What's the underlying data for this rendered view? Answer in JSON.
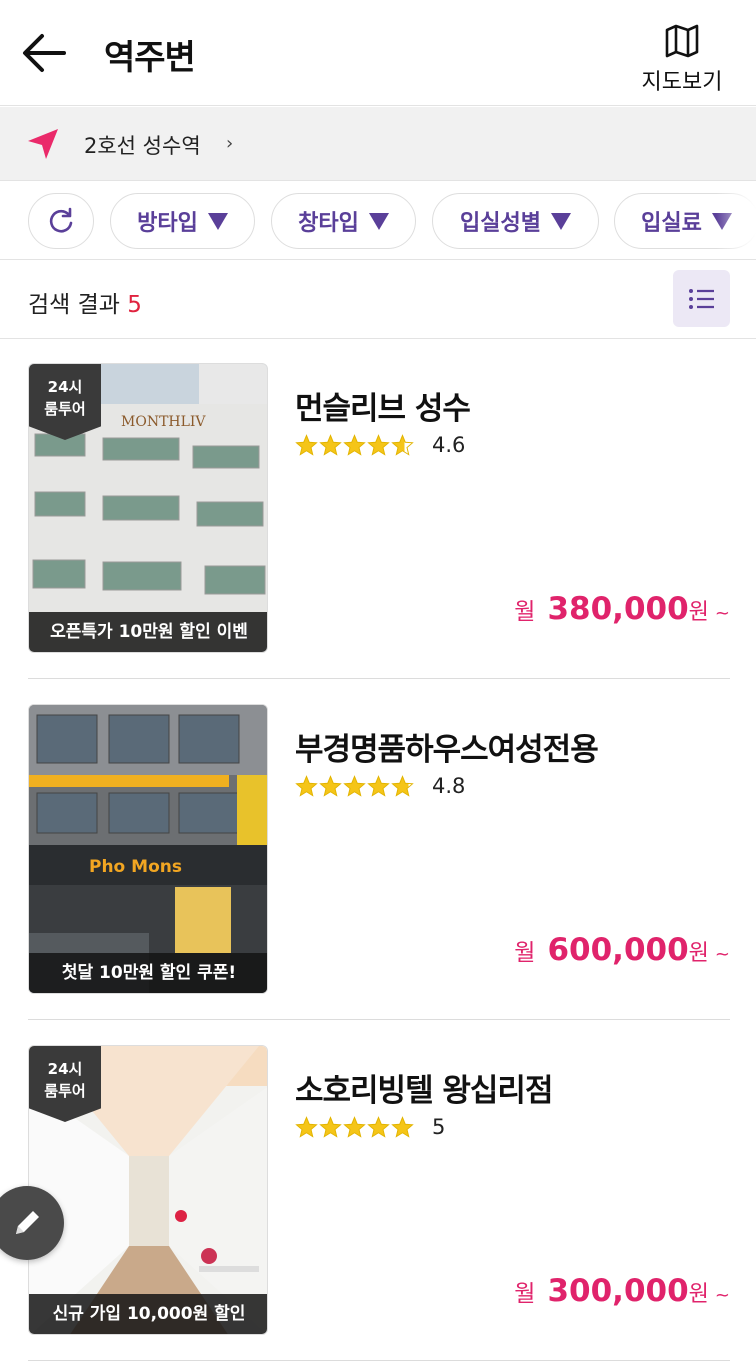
{
  "header": {
    "title": "역주변",
    "map_label": "지도보기"
  },
  "location": {
    "text": "2호선 성수역",
    "chevron": "›"
  },
  "filters": [
    {
      "label": "방타입"
    },
    {
      "label": "창타입"
    },
    {
      "label": "입실성별"
    },
    {
      "label": "입실료"
    }
  ],
  "results": {
    "label": "검색 결과",
    "count": "5"
  },
  "listings": [
    {
      "name": "먼슬리브 성수",
      "rating": "4.6",
      "rating_value": 4.6,
      "badge": [
        "24시",
        "룸투어"
      ],
      "promo": "오픈특가 10만원 할인 이벤",
      "price_prefix": "월",
      "price": "380,000",
      "price_suffix": "원",
      "price_tilde": "~",
      "sign_text": "MONTHLIV"
    },
    {
      "name": "부경명품하우스여성전용",
      "rating": "4.8",
      "rating_value": 4.8,
      "badge": [],
      "promo": "첫달 10만원 할인 쿠폰!",
      "price_prefix": "월",
      "price": "600,000",
      "price_suffix": "원",
      "price_tilde": "~",
      "sign_text": "Pho Mons"
    },
    {
      "name": "소호리빙텔 왕십리점",
      "rating": "5",
      "rating_value": 5,
      "badge": [
        "24시",
        "룸투어"
      ],
      "promo": "신규 가입 10,000원 할인",
      "price_prefix": "월",
      "price": "300,000",
      "price_suffix": "원",
      "price_tilde": "~",
      "sign_text": ""
    }
  ],
  "colors": {
    "accent_purple": "#5a3f99",
    "price_pink": "#e0236b",
    "count_red": "#e0233f",
    "star_yellow": "#f5c518",
    "location_pink": "#ea2a6a"
  },
  "icons": {
    "back": "arrow-left-icon",
    "map": "map-icon",
    "location": "navigation-arrow-icon",
    "refresh": "refresh-icon",
    "list": "list-icon",
    "edit": "pencil-icon",
    "star": "star-icon"
  }
}
